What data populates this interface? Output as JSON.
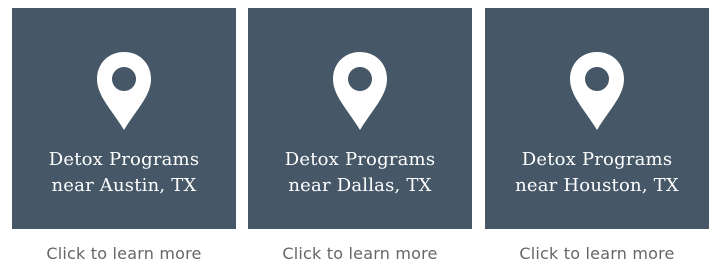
{
  "theme": {
    "card_background": "#465868",
    "card_text": "#ffffff",
    "link_text": "#666666",
    "page_background": "#ffffff"
  },
  "cards": [
    {
      "icon": "map-pin-icon",
      "title_line1": "Detox Programs",
      "title_line2": "near Austin, TX",
      "cta": "Click to learn more"
    },
    {
      "icon": "map-pin-icon",
      "title_line1": "Detox Programs",
      "title_line2": "near Dallas, TX",
      "cta": "Click to learn more"
    },
    {
      "icon": "map-pin-icon",
      "title_line1": "Detox Programs",
      "title_line2": "near Houston, TX",
      "cta": "Click to learn more"
    }
  ]
}
